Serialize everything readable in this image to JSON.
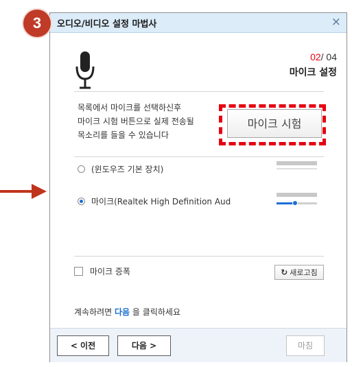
{
  "annotation": {
    "step_number": "3"
  },
  "dialog": {
    "title": "오디오/비디오 설정 마법사",
    "close_label": "×"
  },
  "step": {
    "current": "02",
    "separator": "/ ",
    "total": "04",
    "name": "마이크 설정"
  },
  "instructions": [
    "목록에서 마이크를 선택하신후",
    "마이크 시험 버튼으로 실제 전송될",
    "목소리를 들을 수 있습니다"
  ],
  "test_button_label": "마이크 시험",
  "devices": [
    {
      "label": "(윈도우즈 기본 장치)",
      "selected": false
    },
    {
      "label": "마이크(Realtek High Definition Aud",
      "selected": true
    }
  ],
  "volume_level": 0.45,
  "mic_boost_label": "마이크 증폭",
  "refresh_label": "새로고침",
  "footer": {
    "prefix": "계속하려면 ",
    "keyword": "다음",
    "suffix": " 을 클릭하세요"
  },
  "buttons": {
    "prev": "< 이전",
    "next": "다음 >",
    "finish": "마침"
  },
  "colors": {
    "accent": "#1a6fd6",
    "highlight": "#e60012",
    "badge": "#c03a28",
    "titlebar": "#dcecf9"
  },
  "icons": [
    "microphone-icon",
    "refresh-icon",
    "arrow-right-icon",
    "close-icon"
  ]
}
